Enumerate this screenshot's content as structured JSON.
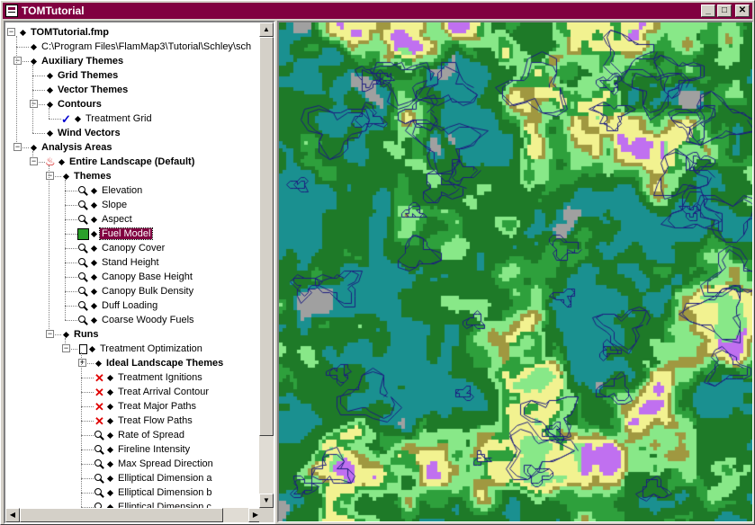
{
  "window": {
    "title": "TOMTutorial",
    "buttons": {
      "minimize": "_",
      "maximize": "□",
      "close": "✕"
    }
  },
  "tree": {
    "nodes": [
      {
        "id": "root",
        "label": "TOMTutorial.fmp",
        "level": 0,
        "bold": true,
        "expander": "-",
        "icon": "none"
      },
      {
        "id": "path",
        "label": "C:\\Program Files\\FlamMap3\\Tutorial\\Schley\\sch",
        "level": 1,
        "bold": false,
        "expander": "",
        "icon": "none"
      },
      {
        "id": "aux",
        "label": "Auxiliary Themes",
        "level": 1,
        "bold": true,
        "expander": "-",
        "icon": "none"
      },
      {
        "id": "grid",
        "label": "Grid Themes",
        "level": 2,
        "bold": true,
        "expander": "",
        "icon": "none"
      },
      {
        "id": "vector",
        "label": "Vector Themes",
        "level": 2,
        "bold": true,
        "expander": "",
        "icon": "none"
      },
      {
        "id": "contours",
        "label": "Contours",
        "level": 2,
        "bold": true,
        "expander": "-",
        "icon": "none"
      },
      {
        "id": "treatgrid",
        "label": "Treatment Grid",
        "level": 3,
        "bold": false,
        "expander": "",
        "icon": "check"
      },
      {
        "id": "wind",
        "label": "Wind Vectors",
        "level": 2,
        "bold": true,
        "expander": "",
        "icon": "none"
      },
      {
        "id": "analysis",
        "label": "Analysis Areas",
        "level": 1,
        "bold": true,
        "expander": "-",
        "icon": "none"
      },
      {
        "id": "entire",
        "label": "Entire Landscape (Default)",
        "level": 2,
        "bold": true,
        "expander": "-",
        "icon": "fire"
      },
      {
        "id": "themes",
        "label": "Themes",
        "level": 3,
        "bold": true,
        "expander": "-",
        "icon": "none"
      },
      {
        "id": "elev",
        "label": "Elevation",
        "level": 4,
        "bold": false,
        "expander": "",
        "icon": "mag"
      },
      {
        "id": "slope",
        "label": "Slope",
        "level": 4,
        "bold": false,
        "expander": "",
        "icon": "mag"
      },
      {
        "id": "aspect",
        "label": "Aspect",
        "level": 4,
        "bold": false,
        "expander": "",
        "icon": "mag"
      },
      {
        "id": "fuel",
        "label": "Fuel Model",
        "level": 4,
        "bold": false,
        "expander": "",
        "icon": "green",
        "selected": true
      },
      {
        "id": "cancov",
        "label": "Canopy Cover",
        "level": 4,
        "bold": false,
        "expander": "",
        "icon": "mag"
      },
      {
        "id": "standh",
        "label": "Stand Height",
        "level": 4,
        "bold": false,
        "expander": "",
        "icon": "mag"
      },
      {
        "id": "cbh",
        "label": "Canopy Base Height",
        "level": 4,
        "bold": false,
        "expander": "",
        "icon": "mag"
      },
      {
        "id": "cbd",
        "label": "Canopy Bulk Density",
        "level": 4,
        "bold": false,
        "expander": "",
        "icon": "mag"
      },
      {
        "id": "duff",
        "label": "Duff Loading",
        "level": 4,
        "bold": false,
        "expander": "",
        "icon": "mag"
      },
      {
        "id": "cwf",
        "label": "Coarse Woody Fuels",
        "level": 4,
        "bold": false,
        "expander": "",
        "icon": "mag"
      },
      {
        "id": "runs",
        "label": "Runs",
        "level": 3,
        "bold": true,
        "expander": "-",
        "icon": "none"
      },
      {
        "id": "topt",
        "label": "Treatment Optimization",
        "level": 4,
        "bold": false,
        "expander": "-",
        "icon": "doc"
      },
      {
        "id": "ideal",
        "label": "Ideal Landscape Themes",
        "level": 5,
        "bold": true,
        "expander": "+",
        "icon": "none"
      },
      {
        "id": "tign",
        "label": "Treatment Ignitions",
        "level": 5,
        "bold": false,
        "expander": "",
        "icon": "x"
      },
      {
        "id": "tarr",
        "label": "Treat Arrival Contour",
        "level": 5,
        "bold": false,
        "expander": "",
        "icon": "x"
      },
      {
        "id": "tmaj",
        "label": "Treat Major Paths",
        "level": 5,
        "bold": false,
        "expander": "",
        "icon": "x"
      },
      {
        "id": "tflow",
        "label": "Treat Flow Paths",
        "level": 5,
        "bold": false,
        "expander": "",
        "icon": "x"
      },
      {
        "id": "ros",
        "label": "Rate of Spread",
        "level": 5,
        "bold": false,
        "expander": "",
        "icon": "mag"
      },
      {
        "id": "fli",
        "label": "Fireline Intensity",
        "level": 5,
        "bold": false,
        "expander": "",
        "icon": "mag"
      },
      {
        "id": "msd",
        "label": "Max Spread Direction",
        "level": 5,
        "bold": false,
        "expander": "",
        "icon": "mag"
      },
      {
        "id": "ella",
        "label": "Elliptical Dimension a",
        "level": 5,
        "bold": false,
        "expander": "",
        "icon": "mag"
      },
      {
        "id": "ellb",
        "label": "Elliptical Dimension b",
        "level": 5,
        "bold": false,
        "expander": "",
        "icon": "mag"
      },
      {
        "id": "ellc",
        "label": "Elliptical Dimension c",
        "level": 5,
        "bold": false,
        "expander": "",
        "icon": "mag"
      }
    ]
  },
  "map": {
    "theme": "Fuel Model",
    "palette": {
      "teal": "#1a9090",
      "dark_green": "#1e7a28",
      "mid_green": "#2ea03c",
      "light_green": "#88e888",
      "yellow": "#f2f290",
      "olive": "#a09840",
      "violet": "#c070f0",
      "gray": "#a0a0a0",
      "contour": "#1c1c80"
    }
  }
}
